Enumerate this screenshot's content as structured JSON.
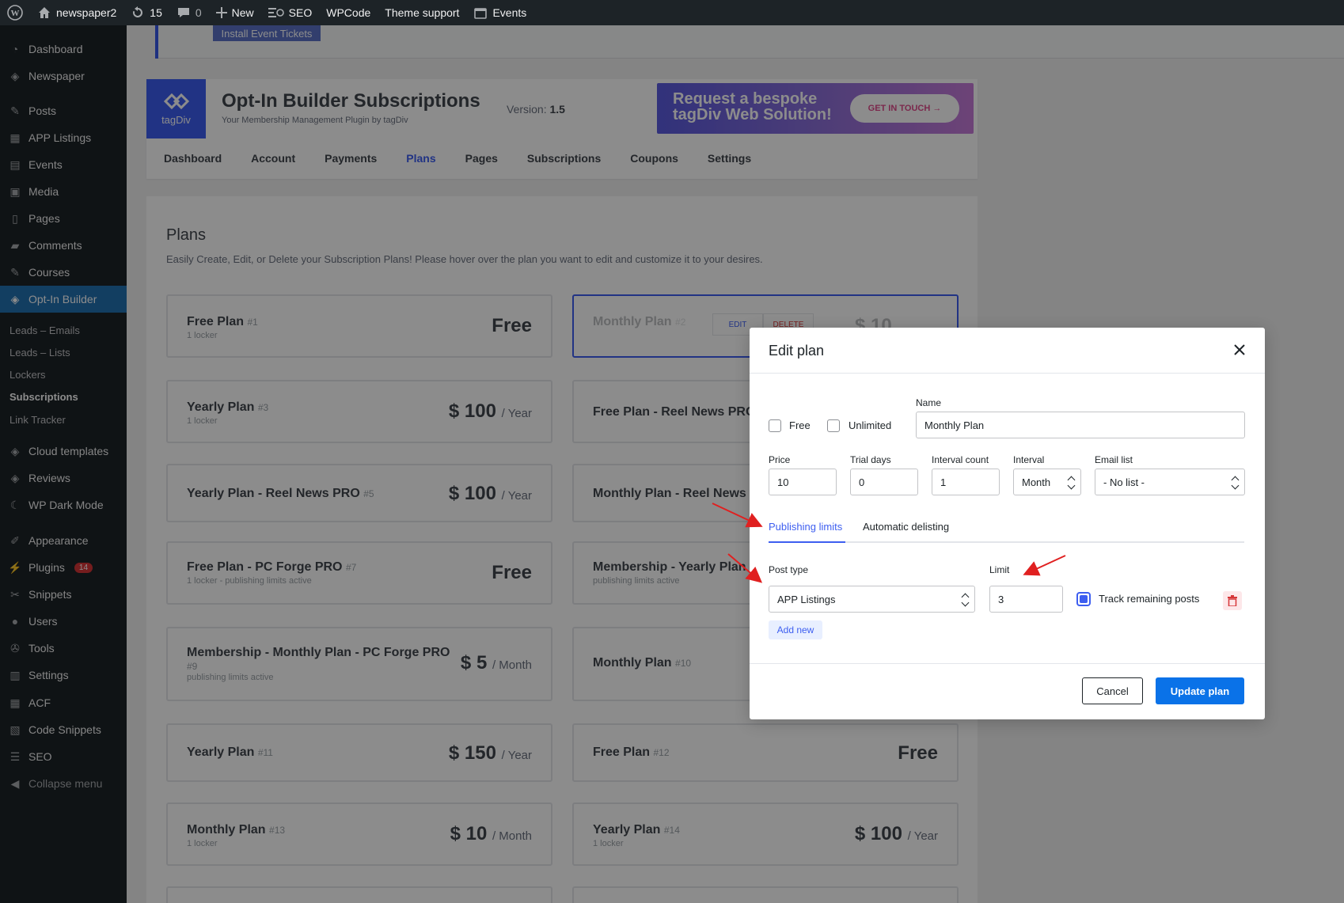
{
  "adminbar": {
    "site": "newspaper2",
    "updates": "15",
    "comments": "0",
    "new": "New",
    "seo": "SEO",
    "wpcode": "WPCode",
    "theme_support": "Theme support",
    "events": "Events"
  },
  "sidebar": {
    "items": [
      {
        "label": "Dashboard",
        "icon": "dashboard-icon"
      },
      {
        "label": "Newspaper",
        "icon": "tagdiv-icon"
      },
      {
        "label": "Posts",
        "icon": "pin-icon"
      },
      {
        "label": "APP Listings",
        "icon": "grid-icon"
      },
      {
        "label": "Events",
        "icon": "calendar-icon"
      },
      {
        "label": "Media",
        "icon": "media-icon"
      },
      {
        "label": "Pages",
        "icon": "page-icon"
      },
      {
        "label": "Comments",
        "icon": "comment-icon"
      },
      {
        "label": "Courses",
        "icon": "pin-icon"
      },
      {
        "label": "Opt-In Builder",
        "icon": "tagdiv-icon"
      },
      {
        "label": "Cloud templates",
        "icon": "tagdiv-icon"
      },
      {
        "label": "Reviews",
        "icon": "tagdiv-icon"
      },
      {
        "label": "WP Dark Mode",
        "icon": "moon-icon"
      },
      {
        "label": "Appearance",
        "icon": "brush-icon"
      },
      {
        "label": "Plugins",
        "icon": "plug-icon",
        "badge": "14"
      },
      {
        "label": "Snippets",
        "icon": "scissors-icon"
      },
      {
        "label": "Users",
        "icon": "user-icon"
      },
      {
        "label": "Tools",
        "icon": "wrench-icon"
      },
      {
        "label": "Settings",
        "icon": "settings-icon"
      },
      {
        "label": "ACF",
        "icon": "grid-icon"
      },
      {
        "label": "Code Snippets",
        "icon": "code-icon"
      },
      {
        "label": "SEO",
        "icon": "seo-icon"
      },
      {
        "label": "Collapse menu",
        "icon": "collapse-icon"
      }
    ],
    "submenu": [
      "Leads – Emails",
      "Leads – Lists",
      "Lockers",
      "Subscriptions",
      "Link Tracker"
    ]
  },
  "notice": {
    "button": "Install Event Tickets"
  },
  "plugin": {
    "logo_text": "tagDiv",
    "title": "Opt-In Builder Subscriptions",
    "subtitle": "Your Membership Management Plugin by tagDiv",
    "version_label": "Version:",
    "version": "1.5",
    "banner_text": "Request a bespoke tagDiv Web Solution!",
    "banner_button": "GET IN TOUCH",
    "tabs": [
      "Dashboard",
      "Account",
      "Payments",
      "Plans",
      "Pages",
      "Subscriptions",
      "Coupons",
      "Settings"
    ]
  },
  "plans": {
    "title": "Plans",
    "description": "Easily Create, Edit, or Delete your Subscription Plans! Please hover over the plan you want to edit and customize it to your desires.",
    "cards": [
      {
        "name": "Free Plan",
        "id": "#1",
        "sub": "1 locker",
        "price": "Free",
        "period": ""
      },
      {
        "name": "Monthly Plan",
        "id": "#2",
        "sub": "",
        "price": "$ 10",
        "period": "",
        "edit": "EDIT",
        "delete": "DELETE"
      },
      {
        "name": "Yearly Plan",
        "id": "#3",
        "sub": "1 locker",
        "price": "$ 100",
        "period": "/ Year"
      },
      {
        "name": "Free Plan - Reel News PRO",
        "id": "",
        "sub": "",
        "price": "",
        "period": ""
      },
      {
        "name": "Yearly Plan - Reel News PRO",
        "id": "#5",
        "sub": "",
        "price": "$ 100",
        "period": "/ Year"
      },
      {
        "name": "Monthly Plan - Reel News P",
        "id": "",
        "sub": "",
        "price": "",
        "period": ""
      },
      {
        "name": "Free Plan - PC Forge PRO",
        "id": "#7",
        "sub": "1 locker - publishing limits active",
        "price": "Free",
        "period": ""
      },
      {
        "name": "Membership - Yearly Plan",
        "id": "",
        "sub": "publishing limits active",
        "price": "",
        "period": ""
      },
      {
        "name": "Membership - Monthly Plan - PC Forge PRO",
        "id": "#9",
        "sub": "publishing limits active",
        "price": "$ 5",
        "period": "/ Month"
      },
      {
        "name": "Monthly Plan",
        "id": "#10",
        "sub": "",
        "price": "",
        "period": ""
      },
      {
        "name": "Yearly Plan",
        "id": "#11",
        "sub": "",
        "price": "$ 150",
        "period": "/ Year"
      },
      {
        "name": "Free Plan",
        "id": "#12",
        "sub": "",
        "price": "Free",
        "period": ""
      },
      {
        "name": "Monthly Plan",
        "id": "#13",
        "sub": "1 locker",
        "price": "$ 10",
        "period": "/ Month"
      },
      {
        "name": "Yearly Plan",
        "id": "#14",
        "sub": "1 locker",
        "price": "$ 100",
        "period": "/ Year"
      }
    ]
  },
  "modal": {
    "title": "Edit plan",
    "free_label": "Free",
    "unlimited_label": "Unlimited",
    "name_label": "Name",
    "name_value": "Monthly Plan",
    "price_label": "Price",
    "price_value": "10",
    "trial_label": "Trial days",
    "trial_value": "0",
    "interval_count_label": "Interval count",
    "interval_count_value": "1",
    "interval_label": "Interval",
    "interval_value": "Month",
    "email_list_label": "Email list",
    "email_list_value": "- No list -",
    "tab_publishing": "Publishing limits",
    "tab_delisting": "Automatic delisting",
    "post_type_label": "Post type",
    "post_type_value": "APP Listings",
    "limit_label": "Limit",
    "limit_value": "3",
    "track_label": "Track remaining posts",
    "add_new": "Add new",
    "cancel": "Cancel",
    "update": "Update plan"
  },
  "colors": {
    "accent": "#3d5ef0",
    "update_button": "#0a72e8",
    "annotation": "#e02020"
  }
}
